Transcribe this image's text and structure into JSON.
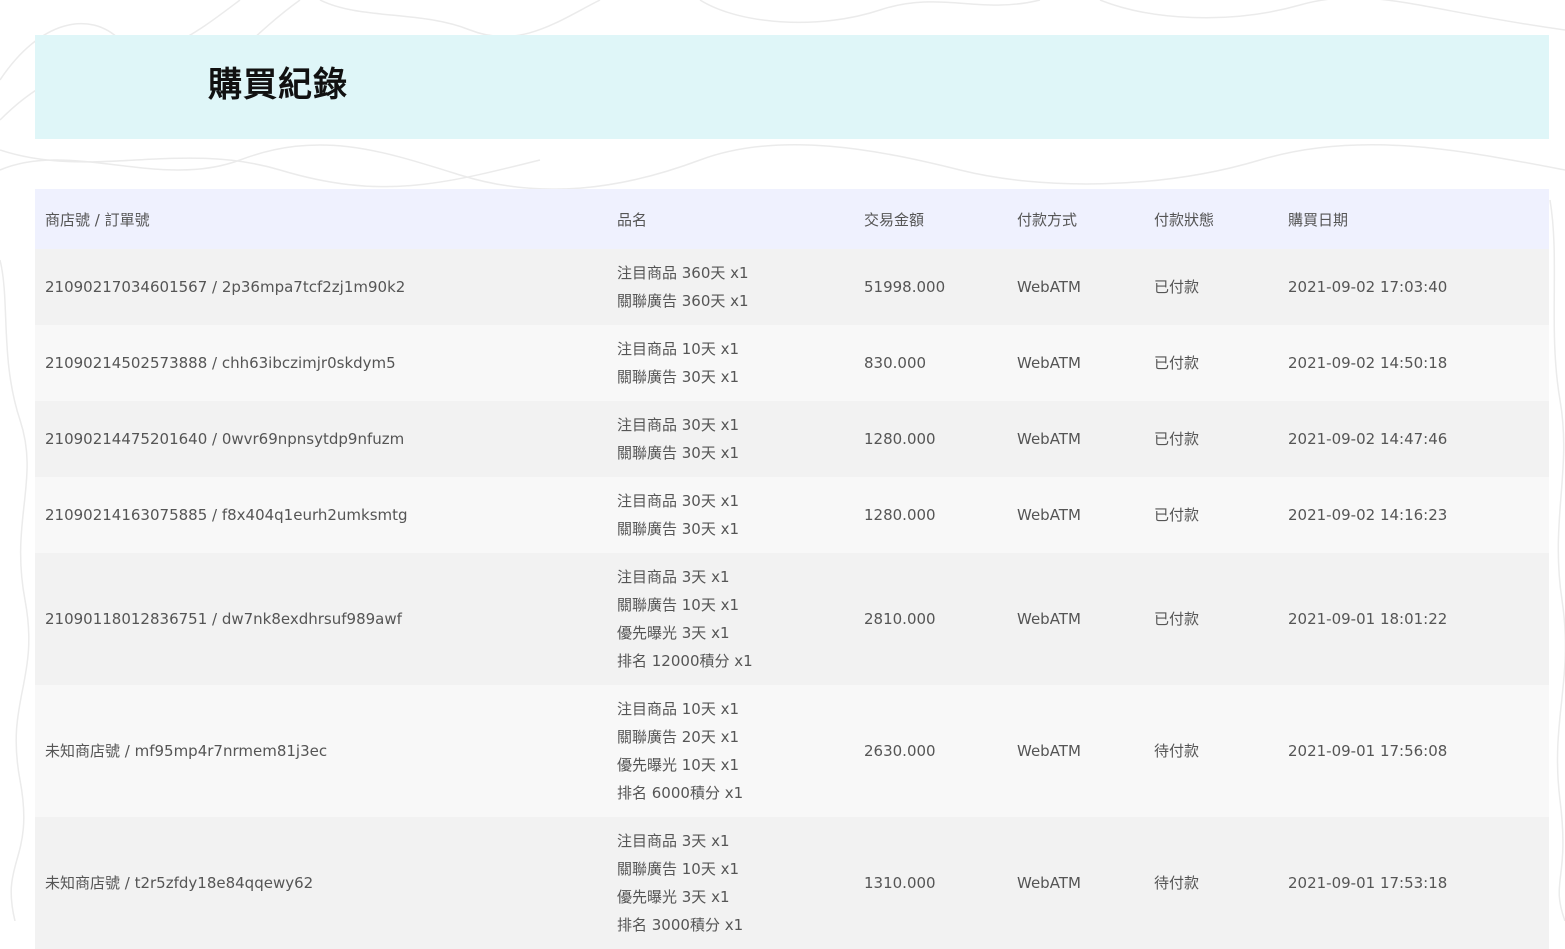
{
  "page": {
    "title": "購買紀錄"
  },
  "table": {
    "headers": {
      "order": "商店號 / 訂單號",
      "product": "品名",
      "amount": "交易金額",
      "payment": "付款方式",
      "status": "付款狀態",
      "date": "購買日期"
    },
    "rows": [
      {
        "order": "21090217034601567 / 2p36mpa7tcf2zj1m90k2",
        "products": [
          "注目商品 360天 x1",
          "關聯廣告 360天 x1"
        ],
        "amount": "51998.000",
        "payment": "WebATM",
        "status": "已付款",
        "date": "2021-09-02 17:03:40"
      },
      {
        "order": "21090214502573888 / chh63ibczimjr0skdym5",
        "products": [
          "注目商品 10天 x1",
          "關聯廣告 30天 x1"
        ],
        "amount": "830.000",
        "payment": "WebATM",
        "status": "已付款",
        "date": "2021-09-02 14:50:18"
      },
      {
        "order": "21090214475201640 / 0wvr69npnsytdp9nfuzm",
        "products": [
          "注目商品 30天 x1",
          "關聯廣告 30天 x1"
        ],
        "amount": "1280.000",
        "payment": "WebATM",
        "status": "已付款",
        "date": "2021-09-02 14:47:46"
      },
      {
        "order": "21090214163075885 / f8x404q1eurh2umksmtg",
        "products": [
          "注目商品 30天 x1",
          "關聯廣告 30天 x1"
        ],
        "amount": "1280.000",
        "payment": "WebATM",
        "status": "已付款",
        "date": "2021-09-02 14:16:23"
      },
      {
        "order": "21090118012836751 / dw7nk8exdhrsuf989awf",
        "products": [
          "注目商品 3天 x1",
          "關聯廣告 10天 x1",
          "優先曝光 3天 x1",
          "排名 12000積分 x1"
        ],
        "amount": "2810.000",
        "payment": "WebATM",
        "status": "已付款",
        "date": "2021-09-01 18:01:22"
      },
      {
        "order": "未知商店號 / mf95mp4r7nrmem81j3ec",
        "products": [
          "注目商品 10天 x1",
          "關聯廣告 20天 x1",
          "優先曝光 10天 x1",
          "排名 6000積分 x1"
        ],
        "amount": "2630.000",
        "payment": "WebATM",
        "status": "待付款",
        "date": "2021-09-01 17:56:08"
      },
      {
        "order": "未知商店號 / t2r5zfdy18e84qqewy62",
        "products": [
          "注目商品 3天 x1",
          "關聯廣告 10天 x1",
          "優先曝光 3天 x1",
          "排名 3000積分 x1"
        ],
        "amount": "1310.000",
        "payment": "WebATM",
        "status": "待付款",
        "date": "2021-09-01 17:53:18"
      }
    ]
  }
}
